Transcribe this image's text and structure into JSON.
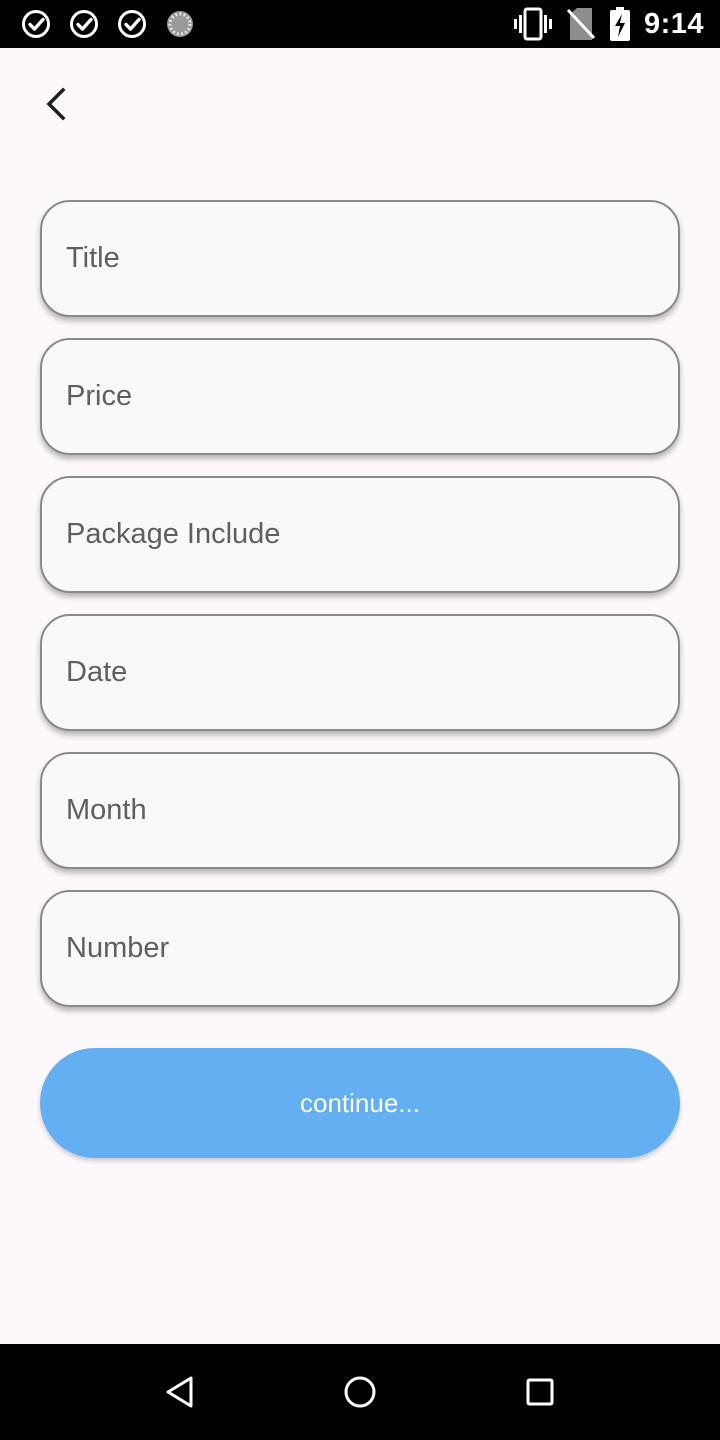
{
  "status_bar": {
    "time": "9:14",
    "left_icons": [
      "check-circle-icon",
      "check-circle-icon",
      "check-circle-icon",
      "loading-spinner-icon"
    ],
    "right_icons": [
      "vibrate-icon",
      "no-sim-icon",
      "battery-charging-icon"
    ]
  },
  "header": {
    "back_icon": "chevron-left-icon"
  },
  "form": {
    "fields": [
      {
        "name": "title",
        "placeholder": "Title",
        "value": ""
      },
      {
        "name": "price",
        "placeholder": "Price",
        "value": ""
      },
      {
        "name": "package_include",
        "placeholder": "Package Include",
        "value": ""
      },
      {
        "name": "date",
        "placeholder": "Date",
        "value": ""
      },
      {
        "name": "month",
        "placeholder": "Month",
        "value": ""
      },
      {
        "name": "number",
        "placeholder": "Number",
        "value": ""
      }
    ],
    "continue_label": "continue..."
  },
  "colors": {
    "background": "#fdf8fc",
    "field_background": "#f9f9f9",
    "field_border": "#8a8a8a",
    "button": "#63aff1",
    "bars": "#000000"
  },
  "nav_bar": {
    "icons": [
      "back-triangle-icon",
      "home-circle-icon",
      "recents-square-icon"
    ]
  }
}
